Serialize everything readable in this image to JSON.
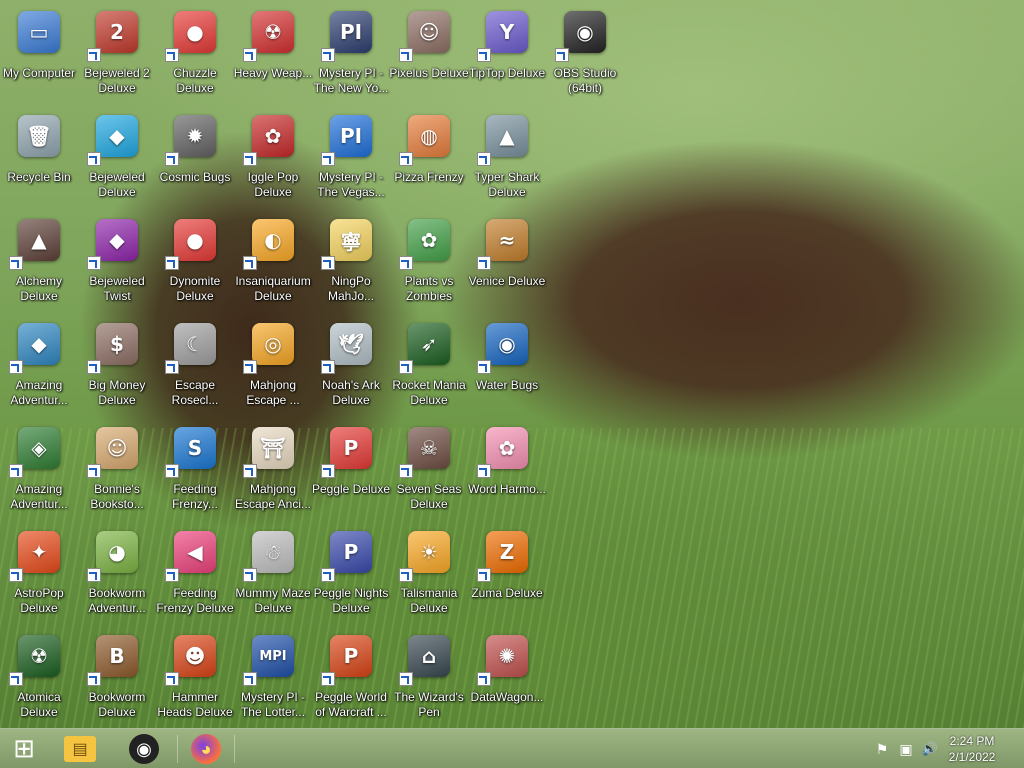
{
  "desktop": {
    "icons": [
      {
        "label": "My Computer",
        "glyph": "▭",
        "bg": "#3a7bd5",
        "shortcut": false
      },
      {
        "label": "Bejeweled 2 Deluxe",
        "glyph": "2",
        "bg": "#c0392b",
        "shortcut": true
      },
      {
        "label": "Chuzzle Deluxe",
        "glyph": "●",
        "bg": "#e53935",
        "shortcut": true
      },
      {
        "label": "Heavy Weap...",
        "glyph": "☢",
        "bg": "#d32f2f",
        "shortcut": true
      },
      {
        "label": "Mystery PI - The New Yo...",
        "glyph": "PI",
        "bg": "#2c3e70",
        "shortcut": true
      },
      {
        "label": "Pixelus Deluxe",
        "glyph": "☺",
        "bg": "#8d6e63",
        "shortcut": true
      },
      {
        "label": "TipTop Deluxe",
        "glyph": "Y",
        "bg": "#6a5acd",
        "shortcut": true
      },
      {
        "label": "OBS Studio (64bit)",
        "glyph": "◉",
        "bg": "#222222",
        "shortcut": true
      },
      {
        "label": "Recycle Bin",
        "glyph": "🗑",
        "bg": "#90a4ae",
        "shortcut": false
      },
      {
        "label": "Bejeweled Deluxe",
        "glyph": "◆",
        "bg": "#1ea7e1",
        "shortcut": true
      },
      {
        "label": "Cosmic Bugs",
        "glyph": "✹",
        "bg": "#616161",
        "shortcut": true
      },
      {
        "label": "Iggle Pop Deluxe",
        "glyph": "✿",
        "bg": "#c62828",
        "shortcut": true
      },
      {
        "label": "Mystery PI - The Vegas...",
        "glyph": "PI",
        "bg": "#1e6fd9",
        "shortcut": true
      },
      {
        "label": "Pizza Frenzy",
        "glyph": "◍",
        "bg": "#e57c3a",
        "shortcut": true
      },
      {
        "label": "Typer Shark Deluxe",
        "glyph": "▲",
        "bg": "#78909c",
        "shortcut": true
      },
      {
        "label": "Alchemy Deluxe",
        "glyph": "▲",
        "bg": "#5d4037",
        "shortcut": true
      },
      {
        "label": "Bejeweled Twist",
        "glyph": "◆",
        "bg": "#8e24aa",
        "shortcut": true
      },
      {
        "label": "Dynomite Deluxe",
        "glyph": "●",
        "bg": "#e53935",
        "shortcut": true
      },
      {
        "label": "Insaniquarium Deluxe",
        "glyph": "◐",
        "bg": "#f9a825",
        "shortcut": true
      },
      {
        "label": "NingPo MahJo...",
        "glyph": "寧",
        "bg": "#f4d35e",
        "shortcut": true
      },
      {
        "label": "Plants vs Zombies",
        "glyph": "✿",
        "bg": "#43a047",
        "shortcut": true
      },
      {
        "label": "Venice Deluxe",
        "glyph": "≈",
        "bg": "#c17d2a",
        "shortcut": true
      },
      {
        "label": "Amazing Adventur...",
        "glyph": "◆",
        "bg": "#2e86c1",
        "shortcut": true
      },
      {
        "label": "Big Money Deluxe",
        "glyph": "$",
        "bg": "#8d6e63",
        "shortcut": true
      },
      {
        "label": "Escape Rosecl...",
        "glyph": "☾",
        "bg": "#9e9e9e",
        "shortcut": true
      },
      {
        "label": "Mahjong Escape ...",
        "glyph": "◎",
        "bg": "#f5a623",
        "shortcut": true
      },
      {
        "label": "Noah's Ark Deluxe",
        "glyph": "🕊",
        "bg": "#b0bec5",
        "shortcut": true
      },
      {
        "label": "Rocket Mania Deluxe",
        "glyph": "➶",
        "bg": "#1b5e20",
        "shortcut": true
      },
      {
        "label": "Water Bugs",
        "glyph": "◉",
        "bg": "#1565c0",
        "shortcut": true
      },
      {
        "label": "Amazing Adventur...",
        "glyph": "◈",
        "bg": "#2e7d32",
        "shortcut": true
      },
      {
        "label": "Bonnie's Booksto...",
        "glyph": "☺",
        "bg": "#d7a86e",
        "shortcut": true
      },
      {
        "label": "Feeding Frenzy...",
        "glyph": "S",
        "bg": "#1976d2",
        "shortcut": true
      },
      {
        "label": "Mahjong Escape Anci...",
        "glyph": "⛩",
        "bg": "#e8d9c0",
        "shortcut": true
      },
      {
        "label": "Peggle Deluxe",
        "glyph": "P",
        "bg": "#e53935",
        "shortcut": true
      },
      {
        "label": "Seven Seas Deluxe",
        "glyph": "☠",
        "bg": "#6d4c41",
        "shortcut": true
      },
      {
        "label": "Word Harmo...",
        "glyph": "✿",
        "bg": "#f48fb1",
        "shortcut": true
      },
      {
        "label": "AstroPop Deluxe",
        "glyph": "✦",
        "bg": "#e64a19",
        "shortcut": true
      },
      {
        "label": "Bookworm Adventur...",
        "glyph": "◕",
        "bg": "#7cb342",
        "shortcut": true
      },
      {
        "label": "Feeding Frenzy Deluxe",
        "glyph": "◀",
        "bg": "#ec407a",
        "shortcut": true
      },
      {
        "label": "Mummy Maze Deluxe",
        "glyph": "☃",
        "bg": "#bdbdbd",
        "shortcut": true
      },
      {
        "label": "Peggle Nights Deluxe",
        "glyph": "P",
        "bg": "#3949ab",
        "shortcut": true
      },
      {
        "label": "Talismania Deluxe",
        "glyph": "☀",
        "bg": "#f9a825",
        "shortcut": true
      },
      {
        "label": "Zuma Deluxe",
        "glyph": "Z",
        "bg": "#ef6c00",
        "shortcut": true
      },
      {
        "label": "Atomica Deluxe",
        "glyph": "☢",
        "bg": "#1b5e20",
        "shortcut": true
      },
      {
        "label": "Bookworm Deluxe",
        "glyph": "B",
        "bg": "#8d5a2b",
        "shortcut": true
      },
      {
        "label": "Hammer Heads Deluxe",
        "glyph": "☻",
        "bg": "#d84315",
        "shortcut": true
      },
      {
        "label": "Mystery PI - The Lotter...",
        "glyph": "MPI",
        "bg": "#1e4fa8",
        "shortcut": true
      },
      {
        "label": "Peggle World of Warcraft ...",
        "glyph": "P",
        "bg": "#d84315",
        "shortcut": true
      },
      {
        "label": "The Wizard's Pen",
        "glyph": "⌂",
        "bg": "#37474f",
        "shortcut": true
      },
      {
        "label": "DataWagon...",
        "glyph": "✺",
        "bg": "#c0504d",
        "shortcut": true
      }
    ]
  },
  "taskbar": {
    "start_glyph": "⊞",
    "explorer_glyph": "▤",
    "obs_glyph": "◉",
    "firefox_glyph": "◕",
    "tray": {
      "flag_glyph": "⚑",
      "network_glyph": "▣",
      "volume_glyph": "🔊"
    },
    "clock": {
      "time": "2:24 PM",
      "date": "2/1/2022"
    }
  }
}
